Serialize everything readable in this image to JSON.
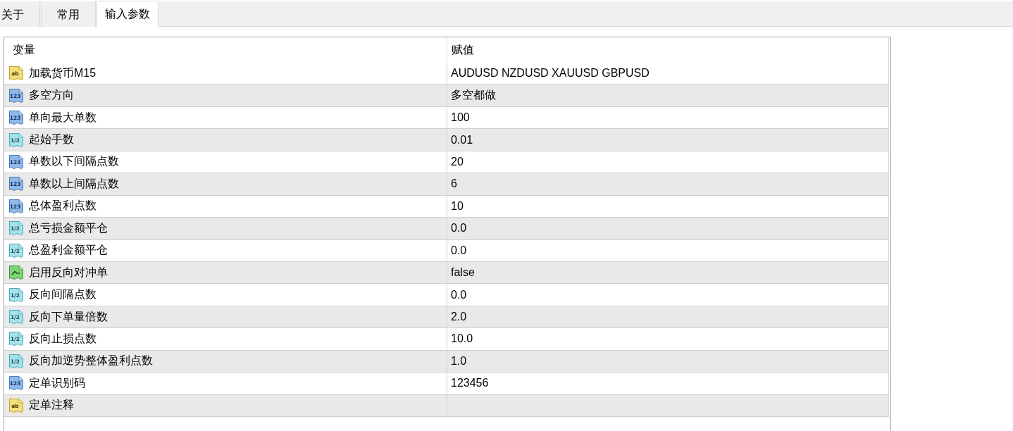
{
  "tabs": [
    {
      "label": "关于",
      "selected": false
    },
    {
      "label": "常用",
      "selected": false
    },
    {
      "label": "输入参数",
      "selected": true
    }
  ],
  "table": {
    "columns": [
      "变量",
      "赋值"
    ],
    "rows": [
      {
        "kind": "string",
        "type_badge": "ab",
        "name": "加载货币M15",
        "value": "AUDUSD NZDUSD XAUUSD GBPUSD"
      },
      {
        "kind": "int",
        "type_badge": "123",
        "name": "多空方向",
        "value": "多空都做"
      },
      {
        "kind": "int",
        "type_badge": "123",
        "name": "单向最大单数",
        "value": "100"
      },
      {
        "kind": "double",
        "type_badge": "1/2",
        "name": "起始手数",
        "value": "0.01"
      },
      {
        "kind": "int",
        "type_badge": "123",
        "name": "单数以下间隔点数",
        "value": "20"
      },
      {
        "kind": "int",
        "type_badge": "123",
        "name": "单数以上间隔点数",
        "value": "6"
      },
      {
        "kind": "int",
        "type_badge": "123",
        "name": "总体盈利点数",
        "value": "10"
      },
      {
        "kind": "double",
        "type_badge": "1/2",
        "name": "总亏损金额平仓",
        "value": "0.0"
      },
      {
        "kind": "double",
        "type_badge": "1/2",
        "name": "总盈利金额平仓",
        "value": "0.0"
      },
      {
        "kind": "bool",
        "name": "启用反向对冲单",
        "value": "false"
      },
      {
        "kind": "double",
        "type_badge": "1/2",
        "name": "反向间隔点数",
        "value": "0.0"
      },
      {
        "kind": "double",
        "type_badge": "1/2",
        "name": "反向下单量倍数",
        "value": "2.0"
      },
      {
        "kind": "double",
        "type_badge": "1/2",
        "name": "反向止损点数",
        "value": "10.0"
      },
      {
        "kind": "double",
        "type_badge": "1/2",
        "name": "反向加逆势整体盈利点数",
        "value": "1.0"
      },
      {
        "kind": "int",
        "type_badge": "123",
        "name": "定单识别码",
        "value": "123456"
      },
      {
        "kind": "string",
        "type_badge": "ab",
        "name": "定单注释"
      }
    ]
  }
}
